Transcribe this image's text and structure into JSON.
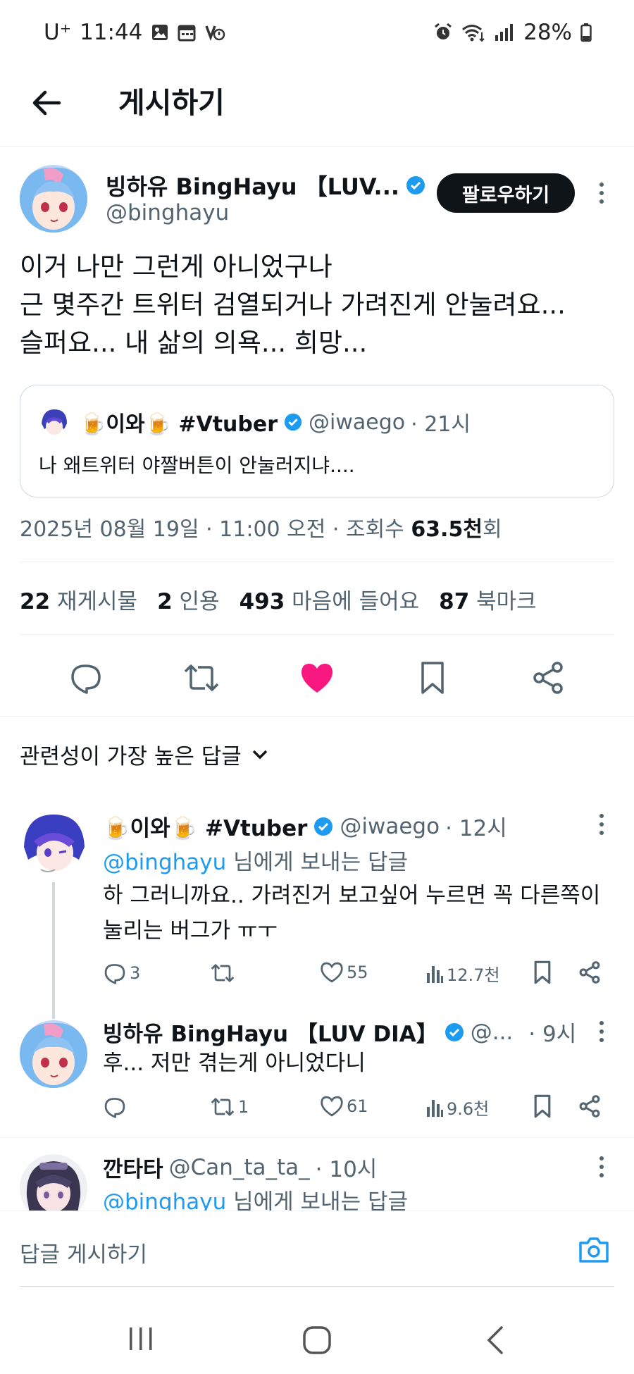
{
  "status_bar": {
    "carrier": "U⁺",
    "time": "11:44",
    "battery": "28%"
  },
  "header": {
    "title": "게시하기"
  },
  "main_post": {
    "author_name": "빙하유 BingHayu 【LUV...",
    "author_handle": "@binghayu",
    "follow_label": "팔로우하기",
    "text_lines": [
      "이거 나만 그런게 아니었구나",
      "근 몇주간 트위터 검열되거나 가려진게 안눌려요...",
      "슬퍼요... 내 삶의 의욕... 희망..."
    ],
    "quote": {
      "author_name": "🍺이와🍺 #Vtuber",
      "author_handle": "@iwaego",
      "time": "· 21시",
      "text": "나 왜트위터 야짤버튼이 안눌러지냐...."
    },
    "timestamp": "2025년 08월 19일 · 11:00 오전 · 조회수 ",
    "views": "63.5천",
    "views_suffix": "회",
    "stats": [
      {
        "count": "22",
        "label": "재게시물"
      },
      {
        "count": "2",
        "label": "인용"
      },
      {
        "count": "493",
        "label": "마음에 들어요"
      },
      {
        "count": "87",
        "label": "북마크"
      }
    ]
  },
  "sort_label": "관련성이 가장 높은 답글",
  "replies": [
    {
      "author_name": "🍺이와🍺 #Vtuber",
      "author_handle": "@iwaego",
      "time": "· 12시",
      "reply_to_handle": "@binghayu",
      "reply_to_suffix": " 님에게 보내는 답글",
      "text_lines": [
        "하 그러니까요.. 가려진거 보고싶어 누르면 꼭 다른쪽이",
        "눌리는 버그가 ㅠㅜ"
      ],
      "comments": "3",
      "retweets": "",
      "likes": "55",
      "views": "12.7천"
    },
    {
      "author_name": "빙하유 BingHayu 【LUV DIA】",
      "author_handle": "@...",
      "time": "· 9시",
      "text_lines": [
        "후... 저만 겪는게 아니었다니"
      ],
      "comments": "",
      "retweets": "1",
      "likes": "61",
      "views": "9.6천"
    },
    {
      "author_name": "깐타타",
      "author_handle": "@Can_ta_ta_",
      "time": "· 10시",
      "reply_to_handle": "@binghayu",
      "reply_to_suffix": " 님에게 보내는 답글"
    }
  ],
  "composer": {
    "placeholder": "답글 게시하기"
  },
  "colors": {
    "like_active": "#f91880",
    "verified": "#1d9bf0",
    "link": "#1d9bf0",
    "muted": "#536471"
  },
  "icons": [
    "back-arrow-icon",
    "verified-icon",
    "more-icon",
    "reply-icon",
    "retweet-icon",
    "heart-icon",
    "bookmark-icon",
    "share-icon",
    "views-icon",
    "chevron-down-icon",
    "camera-icon"
  ]
}
